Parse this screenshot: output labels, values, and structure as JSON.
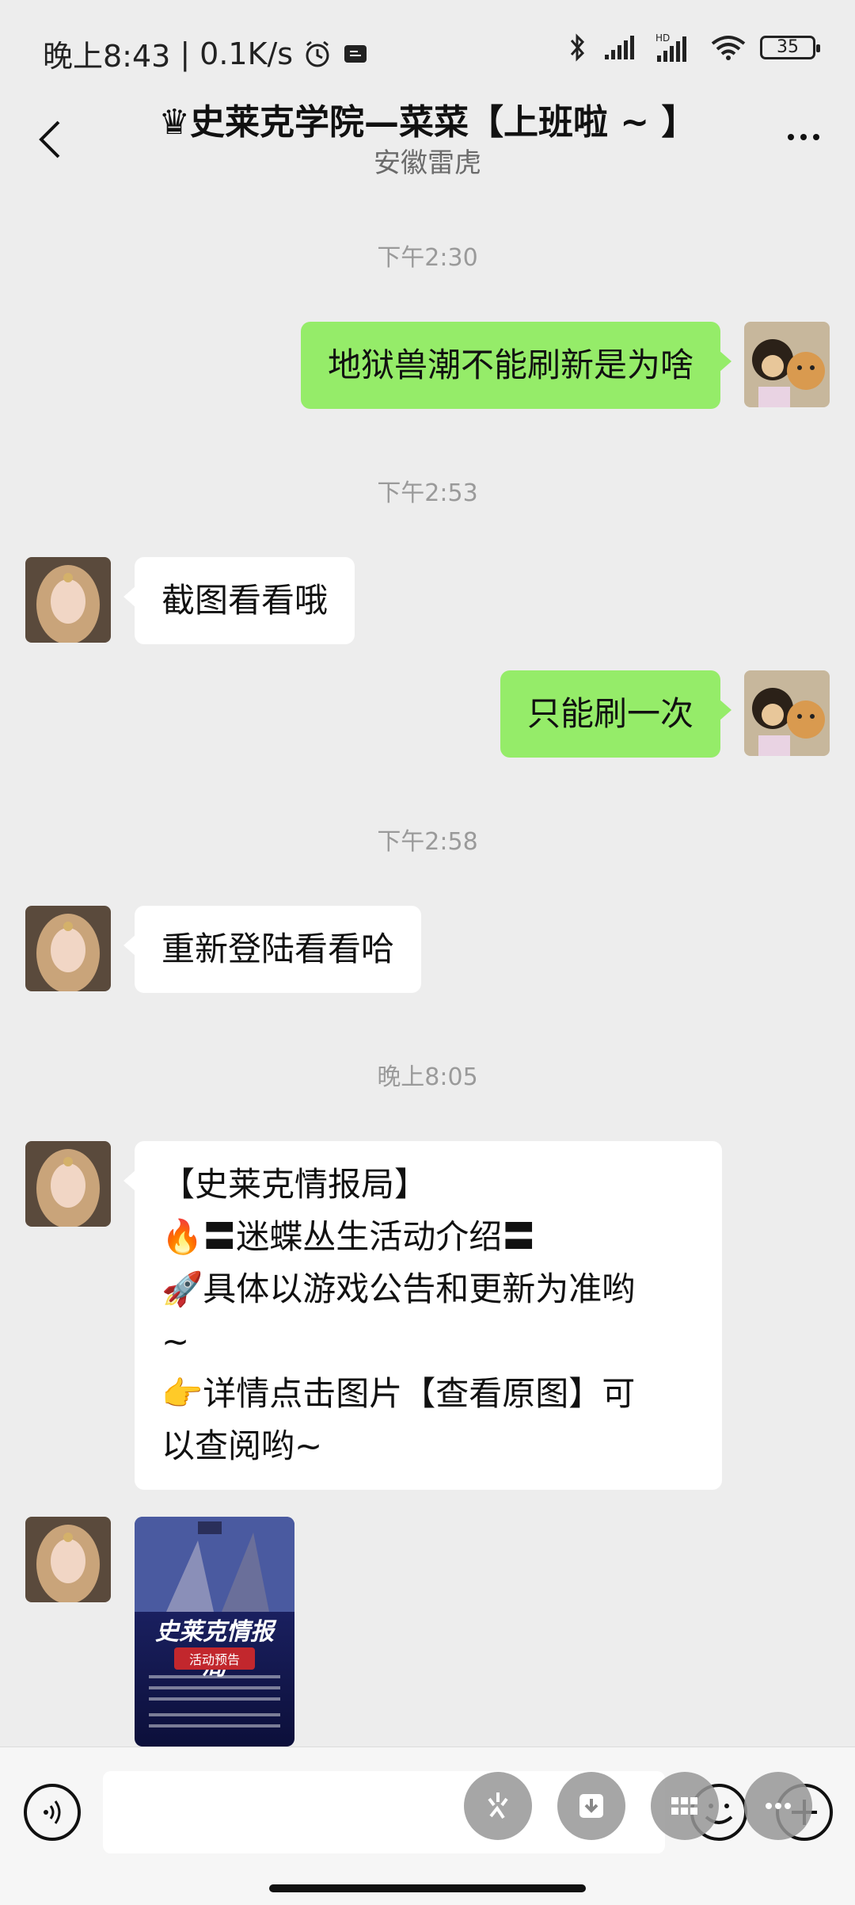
{
  "status_bar": {
    "time": "晚上8:43",
    "speed": "0.1K/s",
    "battery": "35",
    "hd": "HD"
  },
  "header": {
    "title": "♛史莱克学院—菜菜【上班啦 ~ 】",
    "subtitle": "安徽雷虎"
  },
  "messages": {
    "ts1": "下午2:30",
    "m1": "地狱兽潮不能刷新是为啥",
    "ts2": "下午2:53",
    "m2": "截图看看哦",
    "m3": "只能刷一次",
    "ts3": "下午2:58",
    "m4": "重新登陆看看哈",
    "ts4": "晚上8:05",
    "m5_lines": [
      "【史莱克情报局】",
      "🔥〓迷蝶丛生活动介绍〓",
      "🚀具体以游戏公告和更新为准哟",
      "~",
      "👉详情点击图片【查看原图】可",
      "以查阅哟~"
    ]
  },
  "poster": {
    "title": "史莱克情报局",
    "subtitle": "活动预告"
  },
  "colors": {
    "green_bubble": "#95ec69",
    "white_bubble": "#ffffff",
    "background": "#ededed"
  }
}
